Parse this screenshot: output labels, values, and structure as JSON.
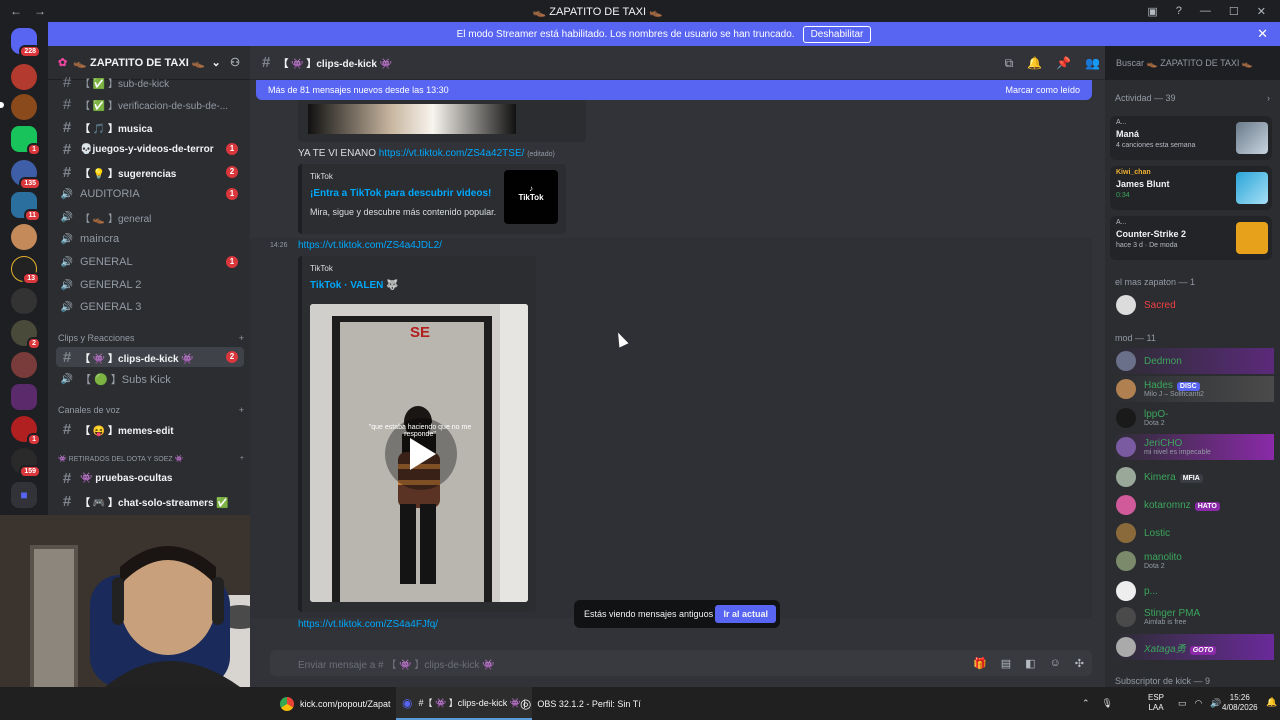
{
  "window": {
    "title": "👞 ZAPATITO DE TAXI 👞",
    "back": "←",
    "forward": "→"
  },
  "banner": {
    "text": "El modo Streamer está habilitado. Los nombres de usuario se han truncado.",
    "button": "Deshabilitar"
  },
  "servers": {
    "badges": [
      "228",
      "1",
      "135",
      "11",
      "13",
      "2",
      "1",
      "159"
    ]
  },
  "server": {
    "name": "👞 ZAPATITO DE TAXI 👞"
  },
  "channels": [
    {
      "icon": "#",
      "label": "【 ✅ 】sub-de-kick",
      "bold": false
    },
    {
      "icon": "#",
      "label": "【 ✅ 】verificacion-de-sub-de-...",
      "bold": false
    },
    {
      "icon": "#",
      "label": "【 🎵 】musica",
      "bold": true
    },
    {
      "icon": "#",
      "label": "💀juegos-y-videos-de-terror",
      "bold": true,
      "count": "1"
    },
    {
      "icon": "#",
      "label": "【 💡 】sugerencias",
      "bold": true,
      "count": "2"
    },
    {
      "icon": "🔊",
      "label": "AUDITORIA",
      "bold": false,
      "count": "1"
    },
    {
      "icon": "🔊",
      "label": "【 👞 】general",
      "bold": false
    },
    {
      "icon": "🔊",
      "label": "maincra",
      "bold": false
    },
    {
      "icon": "🔊",
      "label": "GENERAL",
      "bold": false,
      "count": "1"
    },
    {
      "icon": "🔊",
      "label": "GENERAL 2",
      "bold": false
    },
    {
      "icon": "🔊",
      "label": "GENERAL 3",
      "bold": false
    }
  ],
  "categories": {
    "clips": "Clips y Reacciones",
    "voz": "Canales de voz",
    "dota": "👾 RETIRADOS DEL DOTA Y SOEZ 👾"
  },
  "channels2": [
    {
      "icon": "#",
      "label": "【 👾 】clips-de-kick 👾",
      "count": "2"
    },
    {
      "icon": "🔊",
      "label": "【 🟢 】Subs Kick"
    },
    {
      "icon": "#",
      "label": "【 😝 】memes-edit"
    },
    {
      "icon": "#",
      "label": "👾 pruebas-ocultas"
    },
    {
      "icon": "#",
      "label": "【 🎮 】chat-solo-streamers ✅"
    }
  ],
  "channel": {
    "name": "【 👾 】clips-de-kick 👾",
    "search": "Buscar 👞 ZAPATITO DE TAXI 👞"
  },
  "newbar": {
    "text": "Más de 81 mensajes nuevos desde las 13:30",
    "action": "Marcar como leído"
  },
  "messages": {
    "m1": {
      "text": "YA TE VI ENANO ",
      "link": "https://vt.tiktok.com/ZS4a42TSE/",
      "edited": "(editado)"
    },
    "embed1": {
      "provider": "TikTok",
      "title": "¡Entra a TikTok para descubrir videos!",
      "desc": "Mira, sigue y descubre más contenido popular.",
      "logo": "TikTok"
    },
    "m2": {
      "time": "14:26",
      "link": "https://vt.tiktok.com/ZS4a4JDL2/"
    },
    "embed2": {
      "provider": "TikTok",
      "title": "TikTok · VALEN 🐺",
      "video_sign": "SE",
      "video_caption": "\"que estaba haciendo que no me responde\""
    },
    "m3": {
      "link": "https://vt.tiktok.com/ZS4a4FJfq/"
    }
  },
  "toast": {
    "text": "Estás viendo mensajes antiguos",
    "button": "Ir al actual"
  },
  "composer": {
    "placeholder": "Enviar mensaje a # 【 👾 】clips-de-kick 👾"
  },
  "activity": {
    "header": "Actividad — 39",
    "items": [
      {
        "kicker": "A...",
        "name": "Maná",
        "sub": "4 canciones esta semana"
      },
      {
        "kicker": "Kiwi_chan",
        "name": "James Blunt",
        "sub": "0:34"
      },
      {
        "kicker": "A...",
        "name": "Counter-Strike 2",
        "sub": "hace 3 d · De moda"
      }
    ]
  },
  "members": {
    "cat1": "el mas zapaton — 1",
    "cat2": "mod — 11",
    "cat3": "Subscriptor de kick — 9",
    "top": {
      "name": "Sacred",
      "color": "#f23f43"
    },
    "list": [
      {
        "name": "Dedmon",
        "color": "#3ba55c",
        "sub": "",
        "tag": ""
      },
      {
        "name": "Hades",
        "color": "#3ba55c",
        "sub": "Milo J – Solificanti2",
        "tag": "DISC"
      },
      {
        "name": "lppO-",
        "color": "#3ba55c",
        "sub": "Dota 2",
        "tag": ""
      },
      {
        "name": "JeriCHO",
        "color": "#3ba55c",
        "sub": "mi nivel es impecable",
        "tag": ""
      },
      {
        "name": "Kimera",
        "color": "#3ba55c",
        "sub": "",
        "tag": "MFIA"
      },
      {
        "name": "kotaromnz",
        "color": "#3ba55c",
        "sub": "",
        "tag": "HATO"
      },
      {
        "name": "Lostic",
        "color": "#3ba55c",
        "sub": "",
        "tag": ""
      },
      {
        "name": "manolito",
        "color": "#3ba55c",
        "sub": "Dota 2",
        "tag": ""
      },
      {
        "name": "p...",
        "color": "#3ba55c",
        "sub": "",
        "tag": ""
      },
      {
        "name": "Stinger PMA",
        "color": "#3ba55c",
        "sub": "Aimlab is free",
        "tag": ""
      },
      {
        "name": "Xataga勇",
        "color": "#3ba55c",
        "sub": "",
        "tag": "GOTO"
      }
    ]
  },
  "taskbar": {
    "chrome": "kick.com/popout/Zapat",
    "discord": "#【 👾 】clips-de-kick 👾 |",
    "obs": "OBS 32.1.2 - Perfil: Sin Tí",
    "lang": "ESP",
    "lang2": "LAA",
    "time": "15:26",
    "date": "4/08/2026"
  },
  "colors": {
    "accent": "#5865f2",
    "link": "#00a8fc",
    "badge": "#da373c"
  }
}
